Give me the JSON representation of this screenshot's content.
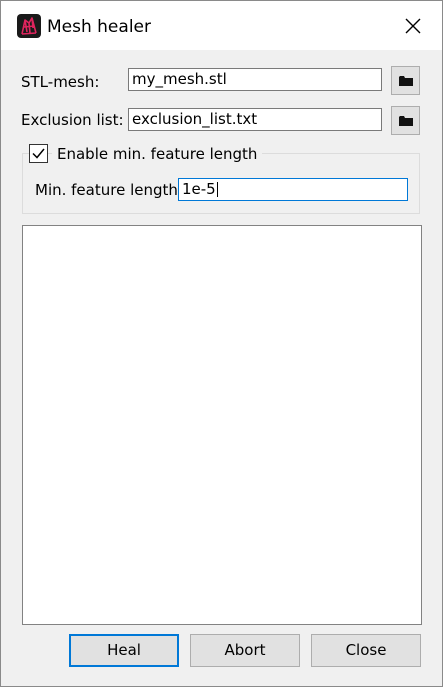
{
  "window": {
    "title": "Mesh healer",
    "app_icon": "mesh-app-icon",
    "close_icon": "close-icon"
  },
  "form": {
    "stl_mesh": {
      "label": "STL-mesh:",
      "value": "my_mesh.stl",
      "browse_icon": "folder-icon"
    },
    "exclusion_list": {
      "label": "Exclusion list:",
      "value": "exclusion_list.txt",
      "browse_icon": "folder-icon"
    },
    "feature_group": {
      "checkbox_label": "Enable min. feature length",
      "checked": true,
      "min_feature_label": "Min. feature length",
      "min_feature_value": "1e-5"
    }
  },
  "log": {
    "content": ""
  },
  "buttons": {
    "heal": "Heal",
    "abort": "Abort",
    "close": "Close"
  },
  "colors": {
    "accent": "#0078d7",
    "icon_bg": "#1a1a1a",
    "icon_mesh": "#e0245e"
  }
}
